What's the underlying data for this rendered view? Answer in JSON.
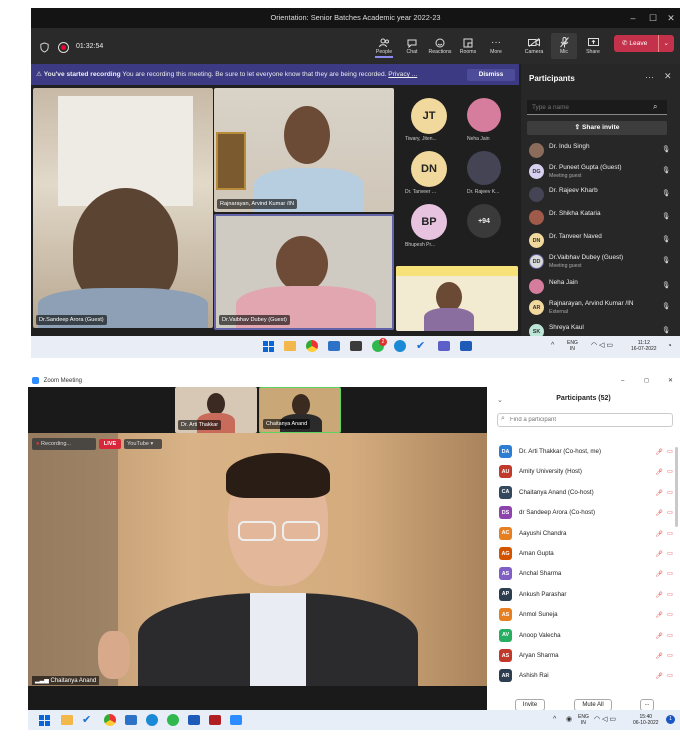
{
  "teams": {
    "title": "Orientation: Senior Batches Academic year 2022-23",
    "timer": "01:32:54",
    "toolbar": [
      {
        "label": "People",
        "icon": "people-icon"
      },
      {
        "label": "Chat",
        "icon": "chat-icon"
      },
      {
        "label": "Reactions",
        "icon": "reactions-icon"
      },
      {
        "label": "Rooms",
        "icon": "rooms-icon"
      },
      {
        "label": "More",
        "icon": "more-icon"
      },
      {
        "label": "Camera",
        "icon": "camera-icon"
      },
      {
        "label": "Mic",
        "icon": "mic-icon"
      },
      {
        "label": "Share",
        "icon": "share-icon"
      }
    ],
    "leave_label": "Leave",
    "banner_title": "You've started recording",
    "banner_text": "You are recording this meeting. Be sure to let everyone know that they are being recorded.",
    "banner_link": "Privacy ...",
    "dismiss_label": "Dismiss",
    "tiles": {
      "sandeep": "Dr.Sandeep Arora (Guest)",
      "rajnarayan": "Rajnarayan, Arvind Kumar /IN",
      "vaibhav": "Dr.Vaibhav Dubey (Guest)"
    },
    "avatars": [
      {
        "initials": "JT",
        "name": "Tiwary, Jiten..."
      },
      {
        "initials": "",
        "name": "Neha Jain"
      },
      {
        "initials": "DN",
        "name": "Dr. Tanveer ..."
      },
      {
        "initials": "",
        "name": "Dr. Rajeev K..."
      },
      {
        "initials": "BP",
        "name": "Bhupesh Pr..."
      }
    ],
    "more_count": "+94",
    "panel": {
      "title": "Participants",
      "search_placeholder": "Type a name",
      "share_invite": "Share invite",
      "rows": [
        {
          "initials": "",
          "name": "Dr. Indu Singh",
          "sub": ""
        },
        {
          "initials": "DG",
          "name": "Dr. Puneet Gupta (Guest)",
          "sub": "Meeting guest"
        },
        {
          "initials": "",
          "name": "Dr. Rajeev Kharb",
          "sub": ""
        },
        {
          "initials": "",
          "name": "Dr. Shikha Kataria",
          "sub": ""
        },
        {
          "initials": "DN",
          "name": "Dr. Tanveer Naved",
          "sub": ""
        },
        {
          "initials": "DD",
          "name": "Dr.Vaibhav Dubey (Guest)",
          "sub": "Meeting guest"
        },
        {
          "initials": "",
          "name": "Neha Jain",
          "sub": ""
        },
        {
          "initials": "AR",
          "name": "Rajnarayan, Arvind Kumar /IN",
          "sub": "External"
        },
        {
          "initials": "SK",
          "name": "Shreya Kaul",
          "sub": ""
        }
      ]
    },
    "taskbar": {
      "lang1": "ENG",
      "lang2": "IN",
      "time": "11:12",
      "date": "16-07-2022",
      "badge": "2"
    }
  },
  "zoom": {
    "title": "Zoom Meeting",
    "thumbs": [
      "Dr. Arti Thakkar",
      "Chaitanya Anand"
    ],
    "recording_label": "Recording...",
    "live_label": "LIVE",
    "youtube_label": "YouTube",
    "speaker_name": "Chaitanya Anand",
    "panel": {
      "title": "Participants (52)",
      "search_placeholder": "Find a participant",
      "rows": [
        {
          "initials": "DA",
          "name": "Dr. Arti Thakkar (Co-host, me)",
          "color": "#2d7dd2"
        },
        {
          "initials": "AU",
          "name": "Amity University (Host)",
          "color": "#c0392b"
        },
        {
          "initials": "CA",
          "name": "Chaitanya Anand (Co-host)",
          "color": "#34495e"
        },
        {
          "initials": "DS",
          "name": "dr Sandeep Arora (Co-host)",
          "color": "#8e44ad"
        },
        {
          "initials": "AC",
          "name": "Aayushi Chandra",
          "color": "#e67e22"
        },
        {
          "initials": "AG",
          "name": "Aman Gupta",
          "color": "#d35400"
        },
        {
          "initials": "AS",
          "name": "Anchal Sharma",
          "color": "#7f5fc4"
        },
        {
          "initials": "AP",
          "name": "Ankush Parashar",
          "color": "#2c3e50"
        },
        {
          "initials": "AS",
          "name": "Anmol Suneja",
          "color": "#e67e22"
        },
        {
          "initials": "AV",
          "name": "Anoop Valecha",
          "color": "#27ae60"
        },
        {
          "initials": "AS",
          "name": "Aryan Sharma",
          "color": "#c0392b"
        },
        {
          "initials": "AR",
          "name": "Ashish Rai",
          "color": "#2c3e50"
        }
      ],
      "invite_label": "Invite",
      "mute_all_label": "Mute All",
      "more_label": "..."
    },
    "taskbar": {
      "lang1": "ENG",
      "lang2": "IN",
      "time": "15:40",
      "date": "06-10-2022"
    }
  }
}
